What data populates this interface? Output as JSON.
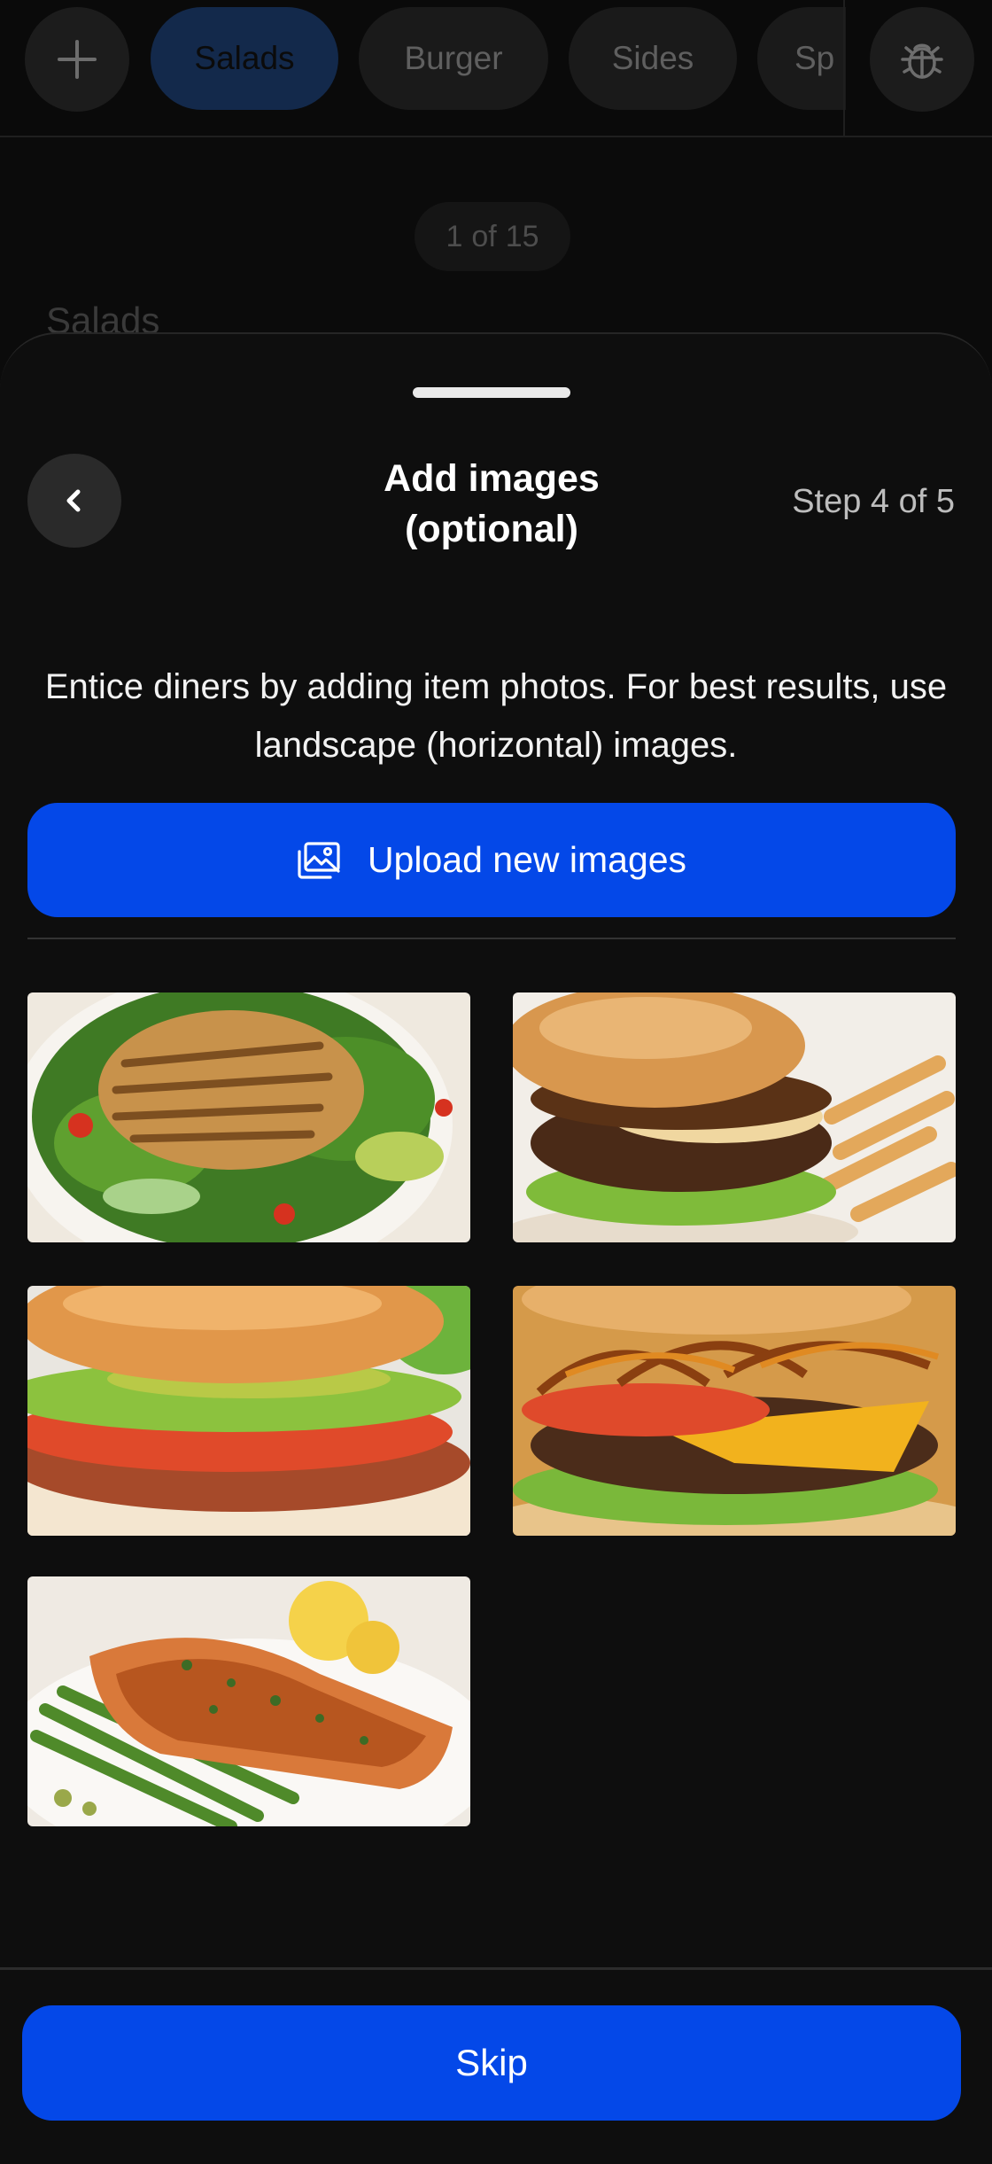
{
  "category_bar": {
    "chips": [
      {
        "label": "Salads",
        "active": true
      },
      {
        "label": "Burger",
        "active": false
      },
      {
        "label": "Sides",
        "active": false
      },
      {
        "label": "Sp",
        "active": false
      }
    ],
    "add_icon": "plus-icon",
    "bug_icon": "bug-icon"
  },
  "pager": {
    "current": "1",
    "separator": "of",
    "total": "15"
  },
  "section_peek": "Salads",
  "sheet": {
    "title": "Add images (optional)",
    "step": "Step 4 of 5",
    "back_icon": "chevron-left-icon",
    "description": "Entice diners by adding item photos. For best results, use landscape (horizontal) images.",
    "upload_label": "Upload new images",
    "upload_icon": "image-gallery-icon",
    "images": [
      {
        "subject": "grilled-chicken-salad"
      },
      {
        "subject": "mushroom-swiss-burger-with-fries"
      },
      {
        "subject": "chicken-avocado-bacon-sandwich"
      },
      {
        "subject": "caramelized-onion-cheeseburger"
      },
      {
        "subject": "grilled-salmon-with-asparagus"
      }
    ],
    "skip_label": "Skip"
  },
  "colors": {
    "primary_blue": "#0448e8",
    "background": "#0e0e0e",
    "chip_active": "#13294b"
  }
}
